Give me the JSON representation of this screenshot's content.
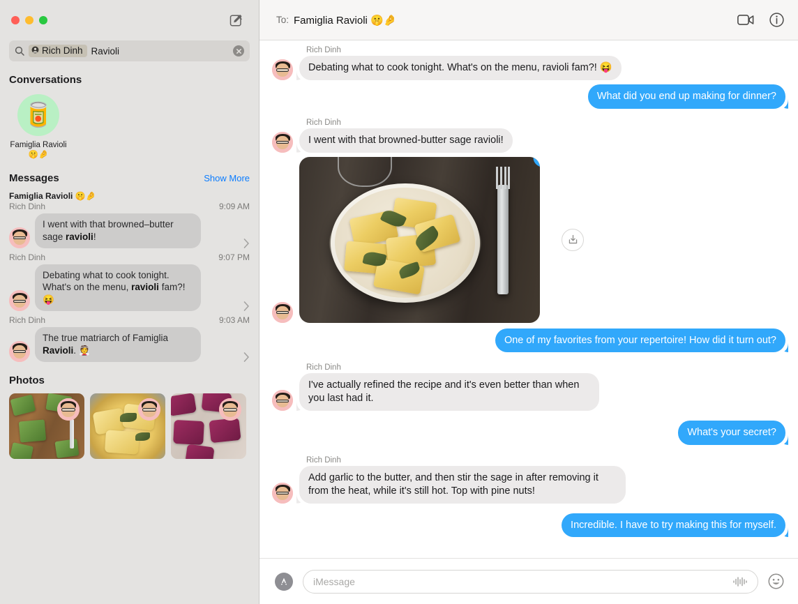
{
  "window": {
    "traffic_lights": [
      "close",
      "minimize",
      "zoom"
    ],
    "colors": {
      "close": "#FF5F57",
      "minimize": "#FEBC2E",
      "zoom": "#28C840",
      "accent_blue": "#0A7CFF",
      "bubble_blue": "#31A8FB",
      "bubble_gray": "#ECEAEA"
    },
    "compose_icon": "compose-icon"
  },
  "sidebar": {
    "search": {
      "icon": "search-icon",
      "token_icon": "person-icon",
      "token_label": "Rich Dinh",
      "query_text": "Ravioli",
      "clear_icon": "clear-icon"
    },
    "conversations": {
      "title": "Conversations",
      "items": [
        {
          "avatar_emoji": "🥫",
          "name": "Famiglia Ravioli 🤫🤌"
        }
      ]
    },
    "messages": {
      "title": "Messages",
      "show_more": "Show More",
      "results": [
        {
          "conversation": "Famiglia Ravioli 🤫🤌",
          "sender": "Rich Dinh",
          "time": "9:09 AM",
          "text_before": "I went with that browned–butter sage ",
          "text_match": "ravioli",
          "text_after": "!",
          "chevron": "chevron-right-icon"
        },
        {
          "conversation": "",
          "sender": "Rich Dinh",
          "time": "9:07 PM",
          "text_before": "Debating what to cook tonight. What's on the menu, ",
          "text_match": "ravioli",
          "text_after": " fam?! 😝",
          "chevron": "chevron-right-icon"
        },
        {
          "conversation": "",
          "sender": "Rich Dinh",
          "time": "9:03 AM",
          "text_before": "The true matriarch of Famiglia ",
          "text_match": "Ravioli",
          "text_after": ". 👰",
          "chevron": "chevron-right-icon"
        }
      ]
    },
    "photos": {
      "title": "Photos",
      "items": [
        {
          "alt": "green spinach ravioli on wooden board with fork"
        },
        {
          "alt": "yellow ravioli with sage and pine nuts on plate"
        },
        {
          "alt": "purple beet ravioli dusted with flour"
        }
      ]
    }
  },
  "chat": {
    "header": {
      "to_label": "To:",
      "recipient": "Famiglia Ravioli 🤫🤌",
      "facetime_icon": "video-camera-icon",
      "info_icon": "info-circle-icon"
    },
    "messages": [
      {
        "type": "text",
        "side": "in",
        "sender": "Rich Dinh",
        "text": "Debating what to cook tonight. What's on the menu, ravioli fam?! 😝"
      },
      {
        "type": "text",
        "side": "out",
        "sender": "",
        "text": "What did you end up making for dinner?"
      },
      {
        "type": "text",
        "side": "in",
        "sender": "Rich Dinh",
        "text": "I went with that browned-butter sage ravioli!"
      },
      {
        "type": "image",
        "side": "in",
        "sender": "",
        "alt": "plate of browned-butter sage ravioli with fork on dark wood table",
        "reaction": "heart",
        "download_icon": "download-icon"
      },
      {
        "type": "text",
        "side": "out",
        "sender": "",
        "text": "One of my favorites from your repertoire! How did it turn out?"
      },
      {
        "type": "text",
        "side": "in",
        "sender": "Rich Dinh",
        "text": "I've actually refined the recipe and it's even better than when you last had it."
      },
      {
        "type": "text",
        "side": "out",
        "sender": "",
        "text": "What's your secret?"
      },
      {
        "type": "text",
        "side": "in",
        "sender": "Rich Dinh",
        "text": "Add garlic to the butter, and then stir the sage in after removing it from the heat, while it's still hot. Top with pine nuts!"
      },
      {
        "type": "text",
        "side": "out",
        "sender": "",
        "text": "Incredible. I have to try making this for myself."
      }
    ],
    "composer": {
      "apps_icon": "app-store-icon",
      "placeholder": "iMessage",
      "value": "",
      "audio_icon": "audio-waveform-icon",
      "emoji_icon": "emoji-smiley-icon"
    }
  }
}
